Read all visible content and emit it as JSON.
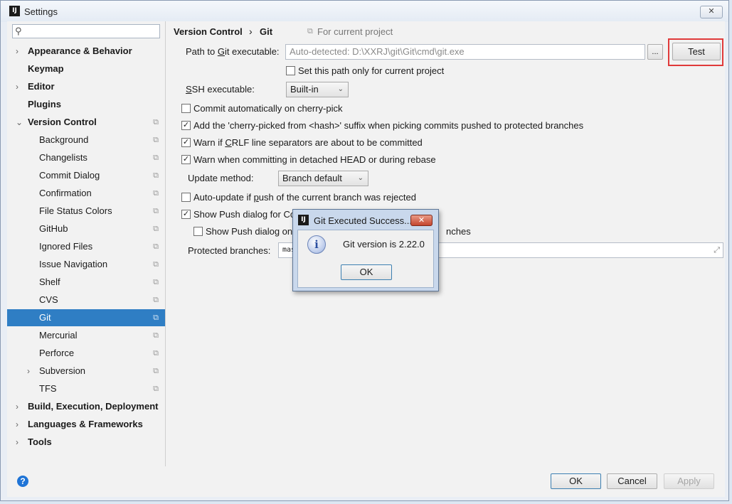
{
  "window": {
    "title": "Settings",
    "app_icon": "IJ",
    "close_glyph": "✕"
  },
  "sidebar": {
    "search_placeholder": "",
    "items": [
      {
        "label": "Appearance & Behavior",
        "level": 0,
        "arrow": "›",
        "bold": true
      },
      {
        "label": "Keymap",
        "level": 0,
        "arrow": "",
        "bold": true
      },
      {
        "label": "Editor",
        "level": 0,
        "arrow": "›",
        "bold": true
      },
      {
        "label": "Plugins",
        "level": 0,
        "arrow": "",
        "bold": true
      },
      {
        "label": "Version Control",
        "level": 0,
        "arrow": "⌄",
        "bold": true,
        "project": true
      },
      {
        "label": "Background",
        "level": 1,
        "project": true
      },
      {
        "label": "Changelists",
        "level": 1,
        "project": true
      },
      {
        "label": "Commit Dialog",
        "level": 1,
        "project": true
      },
      {
        "label": "Confirmation",
        "level": 1,
        "project": true
      },
      {
        "label": "File Status Colors",
        "level": 1,
        "project": true
      },
      {
        "label": "GitHub",
        "level": 1,
        "project": true
      },
      {
        "label": "Ignored Files",
        "level": 1,
        "project": true
      },
      {
        "label": "Issue Navigation",
        "level": 1,
        "project": true
      },
      {
        "label": "Shelf",
        "level": 1,
        "project": true
      },
      {
        "label": "CVS",
        "level": 1,
        "project": true
      },
      {
        "label": "Git",
        "level": 1,
        "project": true,
        "selected": true
      },
      {
        "label": "Mercurial",
        "level": 1,
        "project": true
      },
      {
        "label": "Perforce",
        "level": 1,
        "project": true
      },
      {
        "label": "Subversion",
        "level": 1,
        "arrow": "›",
        "project": true
      },
      {
        "label": "TFS",
        "level": 1,
        "project": true
      },
      {
        "label": "Build, Execution, Deployment",
        "level": 0,
        "arrow": "›",
        "bold": true
      },
      {
        "label": "Languages & Frameworks",
        "level": 0,
        "arrow": "›",
        "bold": true
      },
      {
        "label": "Tools",
        "level": 0,
        "arrow": "›",
        "bold": true
      }
    ]
  },
  "breadcrumb": {
    "parent": "Version Control",
    "separator": "›",
    "current": "Git",
    "scope": "For current project"
  },
  "git": {
    "path_label_pre": "Path to ",
    "path_label_u": "G",
    "path_label_post": "it executable:",
    "path_value": "Auto-detected: D:\\XXRJ\\git\\Git\\cmd\\git.exe",
    "browse_label": "...",
    "test_label": "Test",
    "current_project_only": "Set this path only for current project",
    "ssh_label_u": "S",
    "ssh_label_post": "SH executable:",
    "ssh_value": "Built-in",
    "commit_cherry_pick": "Commit automatically on cherry-pick",
    "add_cherry_picked": "Add the 'cherry-picked from <hash>' suffix when picking commits pushed to protected branches",
    "warn_crlf_pre": "Warn if ",
    "warn_crlf_u": "C",
    "warn_crlf_post": "RLF line separators are about to be committed",
    "warn_detached": "Warn when committing in detached HEAD or during rebase",
    "update_method_label": "Update method:",
    "update_method_value": "Branch default",
    "auto_update_pre": "Auto-update if ",
    "auto_update_u": "p",
    "auto_update_post": "ush of the current branch was rejected",
    "show_push": "Show Push dialog for Cor",
    "show_push_only": "Show Push dialog only",
    "show_push_only_tail": "nches",
    "protected_label": "Protected branches:",
    "protected_value": "mast",
    "checked": {
      "current_project_only": false,
      "commit_cherry_pick": false,
      "add_cherry_picked": true,
      "warn_crlf": true,
      "warn_detached": true,
      "auto_update": false,
      "show_push": true,
      "show_push_only": false
    }
  },
  "dialog": {
    "title": "Git Executed Success...",
    "message": "Git version is 2.22.0",
    "ok_label": "OK",
    "close_glyph": "✕",
    "icon_glyph": "i"
  },
  "footer": {
    "help_glyph": "?",
    "ok_label": "OK",
    "cancel_label": "Cancel",
    "apply_label": "Apply"
  },
  "colors": {
    "selection": "#2f7ec4",
    "highlight": "#e03a3a",
    "help": "#1f74d6"
  }
}
